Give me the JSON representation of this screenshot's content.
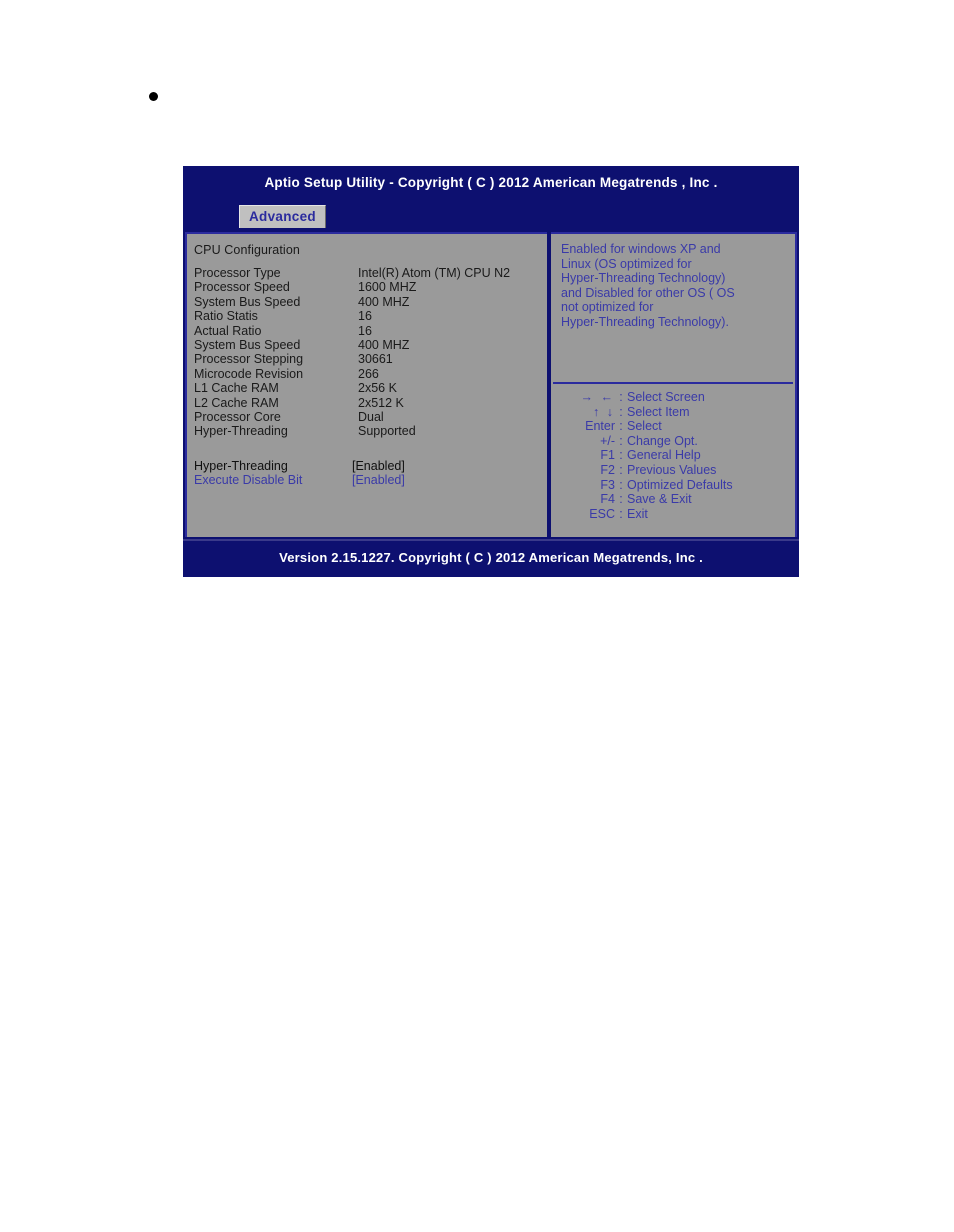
{
  "document": {
    "bullet": "•"
  },
  "bios": {
    "title": "Aptio Setup Utility - Copyright ( C ) 2012 American Megatrends , Inc .",
    "tabs": [
      {
        "label": "Advanced",
        "active": true
      }
    ],
    "left_panel": {
      "section_heading": "CPU Configuration",
      "info_rows": [
        {
          "label": "Processor Type",
          "value": "Intel(R) Atom (TM) CPU N2"
        },
        {
          "label": "Processor Speed",
          "value": "1600 MHZ"
        },
        {
          "label": "System Bus Speed",
          "value": "400 MHZ"
        },
        {
          "label": "Ratio Statis",
          "value": "16"
        },
        {
          "label": "Actual Ratio",
          "value": "16"
        },
        {
          "label": "System Bus Speed",
          "value": "400 MHZ"
        },
        {
          "label": "Processor Stepping",
          "value": "30661"
        },
        {
          "label": "Microcode Revision",
          "value": "266"
        },
        {
          "label": "L1 Cache RAM",
          "value": "2x56 K"
        },
        {
          "label": "L2 Cache RAM",
          "value": "2x512 K"
        },
        {
          "label": "Processor Core",
          "value": "Dual"
        },
        {
          "label": "Hyper-Threading",
          "value": "Supported"
        }
      ],
      "options": [
        {
          "label": "Hyper-Threading",
          "value": "[Enabled]",
          "selected": true
        },
        {
          "label": "Execute Disable Bit",
          "value": "[Enabled]",
          "selected": false
        }
      ]
    },
    "right_panel": {
      "help_text": "Enabled for windows XP and\nLinux (OS optimized for\nHyper-Threading Technology)\nand Disabled for other OS ( OS\nnot optimized for\nHyper-Threading Technology).",
      "keys": [
        {
          "key": "→ ←",
          "colon": ":",
          "desc": "Select Screen",
          "glyph": true
        },
        {
          "key": "↑ ↓",
          "colon": ":",
          "desc": "Select Item",
          "glyph": true
        },
        {
          "key": "Enter",
          "colon": ":",
          "desc": "Select",
          "glyph": false
        },
        {
          "key": "+/-",
          "colon": ":",
          "desc": "Change Opt.",
          "glyph": false
        },
        {
          "key": "F1",
          "colon": ":",
          "desc": "General Help",
          "glyph": false
        },
        {
          "key": "F2",
          "colon": ":",
          "desc": "Previous Values",
          "glyph": false
        },
        {
          "key": "F3",
          "colon": ":",
          "desc": "Optimized Defaults",
          "glyph": false
        },
        {
          "key": "F4",
          "colon": ":",
          "desc": "Save & Exit",
          "glyph": false
        },
        {
          "key": "ESC",
          "colon": ":",
          "desc": "Exit",
          "glyph": false
        }
      ]
    },
    "footer": {
      "text": "Version 2.15.1227. Copyright ( C ) 2012 American Megatrends, Inc ."
    },
    "colors": {
      "window_bg": "#0d1070",
      "panel_bg": "#9a9a9a",
      "panel_border": "#2b2b9e",
      "tab_bg": "#c0c0c0",
      "tab_text": "#2b2b9e",
      "help_text": "#3a3aa8",
      "selected_text": "#101010",
      "title_text": "#ffffff"
    }
  }
}
